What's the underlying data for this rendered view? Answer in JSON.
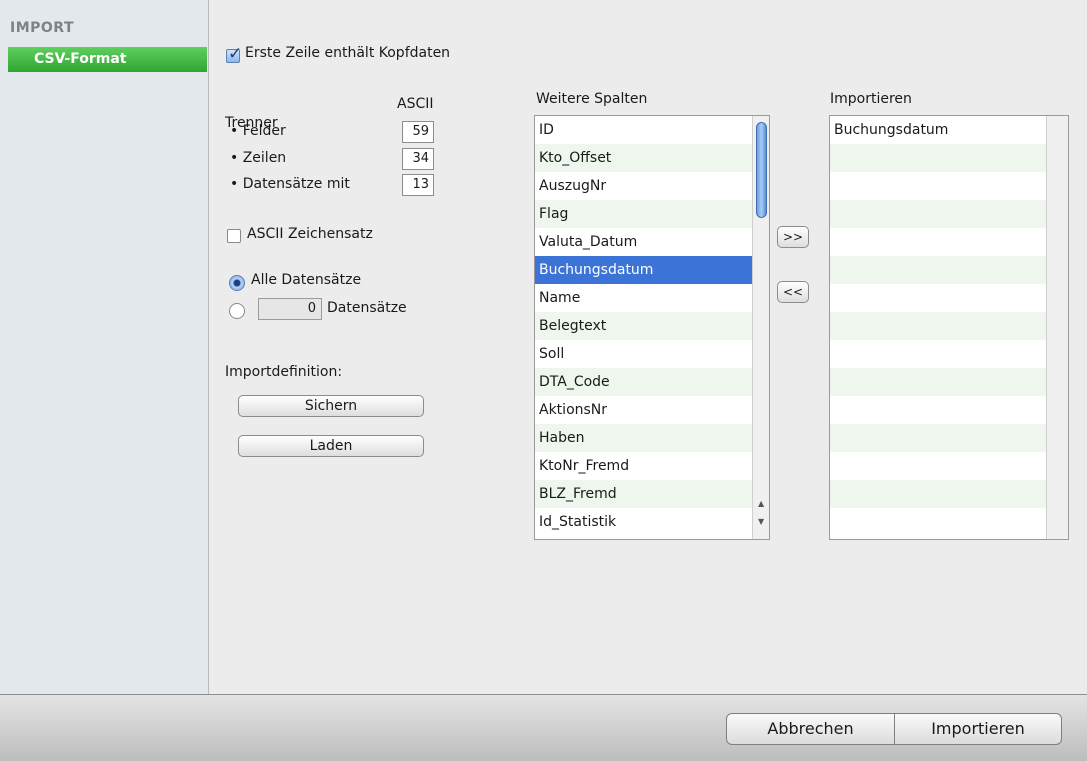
{
  "sidebar": {
    "header": "IMPORT",
    "items": [
      {
        "label": "CSV-Format",
        "selected": true
      }
    ]
  },
  "options": {
    "first_row_header": {
      "label": "Erste Zeile enthält Kopfdaten",
      "checked": true
    },
    "separator": {
      "title": "Trenner",
      "ascii_header": "ASCII",
      "rows": [
        {
          "label": "• Felder",
          "value": "59"
        },
        {
          "label": "• Zeilen",
          "value": "34"
        },
        {
          "label": "• Datensätze mit",
          "value": "13"
        }
      ]
    },
    "ascii_charset": {
      "label": "ASCII Zeichensatz",
      "checked": false
    },
    "records": {
      "all_label": "Alle Datensätze",
      "count_value": "0",
      "count_suffix": "Datensätze",
      "selected": "all"
    },
    "import_definition": {
      "label": "Importdefinition:",
      "save_button": "Sichern",
      "load_button": "Laden"
    }
  },
  "columns": {
    "available_title": "Weitere Spalten",
    "available": [
      "ID",
      "Kto_Offset",
      "AuszugNr",
      "Flag",
      "Valuta_Datum",
      "Buchungsdatum",
      "Name",
      "Belegtext",
      "Soll",
      "DTA_Code",
      "AktionsNr",
      "Haben",
      "KtoNr_Fremd",
      "BLZ_Fremd",
      "Id_Statistik"
    ],
    "selected_available": "Buchungsdatum",
    "add_button": ">>",
    "remove_button": "<<",
    "import_title": "Importieren",
    "import": [
      "Buchungsdatum"
    ]
  },
  "footer": {
    "cancel_button": "Abbrechen",
    "import_button": "Importieren"
  },
  "colors": {
    "sidebar_selected": "#3cb53c",
    "list_selection": "#3b74d6",
    "list_stripe": "#eef6ee"
  }
}
